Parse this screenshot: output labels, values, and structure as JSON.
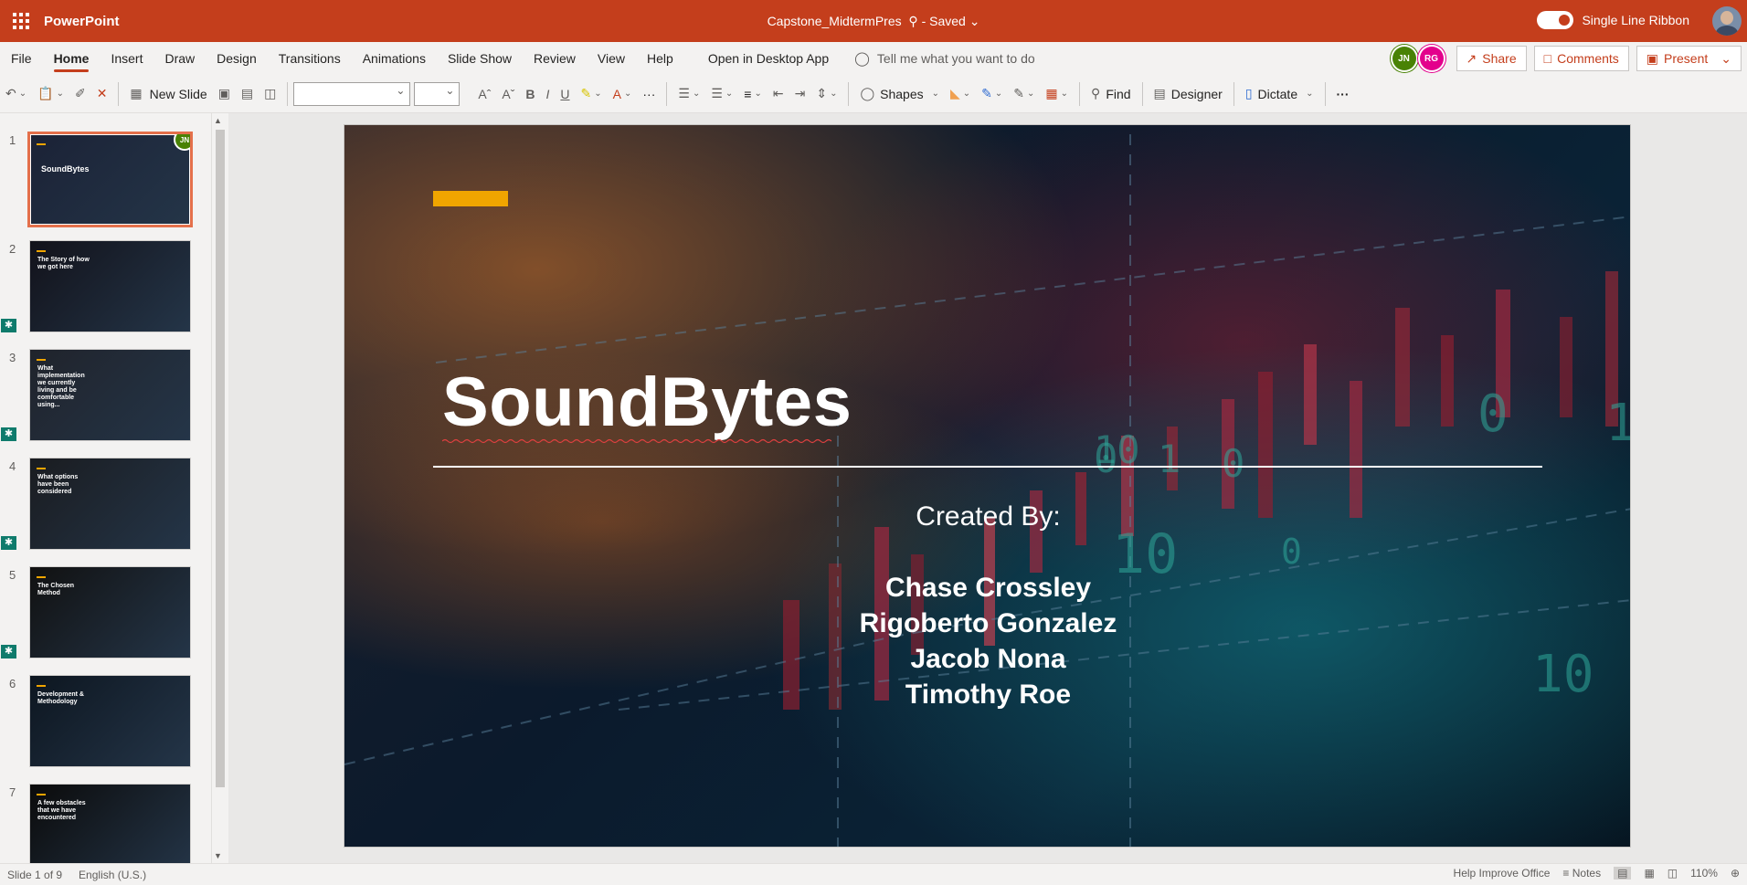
{
  "app": {
    "name": "PowerPoint",
    "doc_title": "Capstone_MidtermPres",
    "save_state": "- Saved",
    "single_line_ribbon": "Single Line Ribbon"
  },
  "menu": {
    "tabs": [
      "File",
      "Home",
      "Insert",
      "Draw",
      "Design",
      "Transitions",
      "Animations",
      "Slide Show",
      "Review",
      "View",
      "Help"
    ],
    "active_tab": "Home",
    "open_desktop": "Open in Desktop App",
    "tell_me": "Tell me what you want to do",
    "presence": [
      {
        "initials": "JN",
        "color": "#498205"
      },
      {
        "initials": "RG",
        "color": "#e3008c"
      }
    ],
    "share": "Share",
    "comments": "Comments",
    "present": "Present"
  },
  "ribbon": {
    "new_slide": "New Slide",
    "shapes": "Shapes",
    "find": "Find",
    "designer": "Designer",
    "dictate": "Dictate",
    "more": "···"
  },
  "thumbnails": [
    {
      "num": "1",
      "title": "SoundBytes",
      "bg": "#1b2236",
      "designer": false,
      "selected": true
    },
    {
      "num": "2",
      "title": "The Story of how we got here",
      "bg": "#12121a",
      "designer": true,
      "selected": false
    },
    {
      "num": "3",
      "title": "What implementation we currently living and be comfortable using...",
      "bg": "#20232b",
      "designer": true,
      "selected": false
    },
    {
      "num": "4",
      "title": "What options have been considered",
      "bg": "#1a1c20",
      "designer": true,
      "selected": false
    },
    {
      "num": "5",
      "title": "The Chosen Method",
      "bg": "#111111",
      "designer": true,
      "selected": false
    },
    {
      "num": "6",
      "title": "Development & Methodology",
      "bg": "#0d1620",
      "designer": false,
      "selected": false
    },
    {
      "num": "7",
      "title": "A few obstacles that we have encountered",
      "bg": "#0b0b0b",
      "designer": false,
      "selected": false
    }
  ],
  "slide": {
    "title": "SoundBytes",
    "created_by": "Created By:",
    "names": [
      "Chase Crossley",
      "Rigoberto Gonzalez",
      "Jacob Nona",
      "Timothy Roe"
    ],
    "accent_color": "#f0a500",
    "digits": [
      "0",
      "10",
      "10",
      "1",
      "0",
      "10",
      "0",
      "10",
      "0"
    ]
  },
  "status": {
    "slide_of": "Slide 1 of 9",
    "language": "English (U.S.)",
    "help_improve": "Help Improve Office",
    "notes": "Notes",
    "zoom": "110%"
  }
}
